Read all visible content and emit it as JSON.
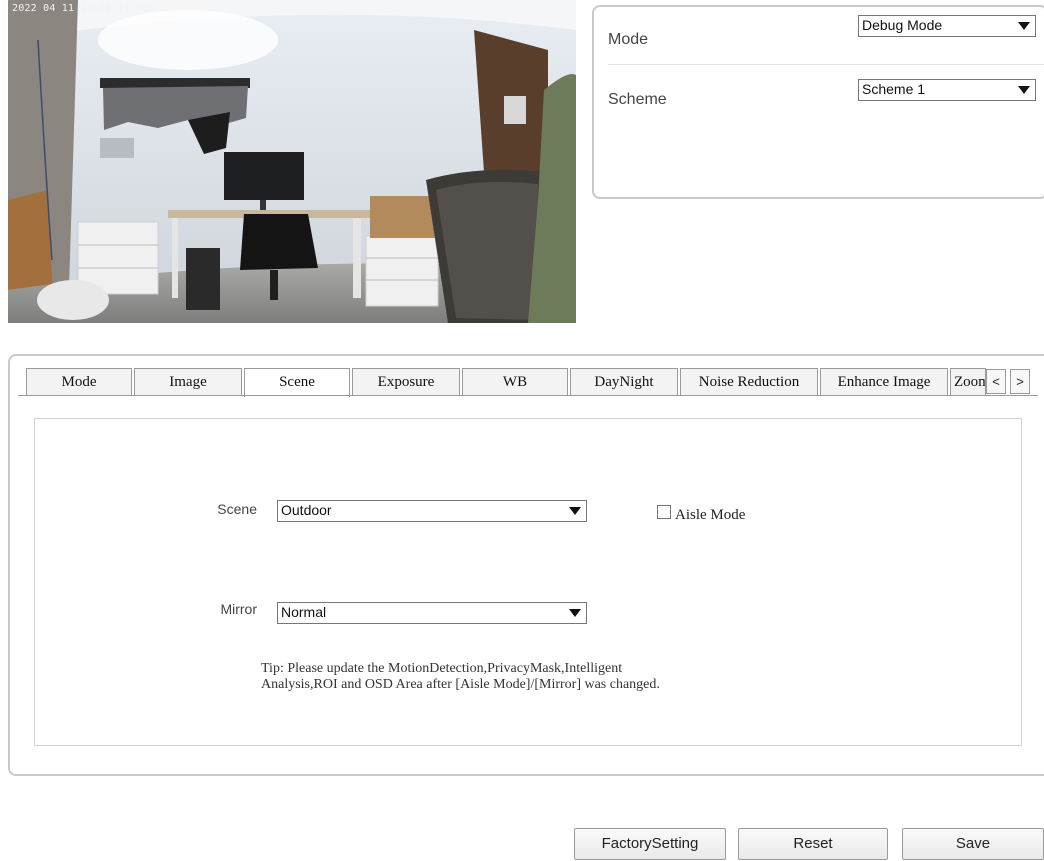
{
  "preview": {
    "osd_time": "2022 04 11 11:59:27 Mon"
  },
  "mode_panel": {
    "mode_label": "Mode",
    "mode_value": "Debug Mode",
    "scheme_label": "Scheme",
    "scheme_value": "Scheme 1"
  },
  "tabs": {
    "mode": "Mode",
    "image": "Image",
    "scene": "Scene",
    "exposure": "Exposure",
    "wb": "WB",
    "daynight": "DayNight",
    "noise_reduction": "Noise Reduction",
    "enhance_image": "Enhance Image",
    "zoom": "Zoom",
    "prev": "<",
    "next": ">",
    "active": "Scene"
  },
  "scene_form": {
    "scene_label": "Scene",
    "scene_value": "Outdoor",
    "aisle_mode_label": "Aisle Mode",
    "aisle_mode_checked": false,
    "mirror_label": "Mirror",
    "mirror_value": "Normal",
    "tip_line1": "Tip: Please update the MotionDetection,PrivacyMask,Intelligent",
    "tip_line2": "Analysis,ROI and OSD Area after [Aisle Mode]/[Mirror] was changed."
  },
  "buttons": {
    "factory": "FactorySetting",
    "reset": "Reset",
    "save": "Save"
  }
}
